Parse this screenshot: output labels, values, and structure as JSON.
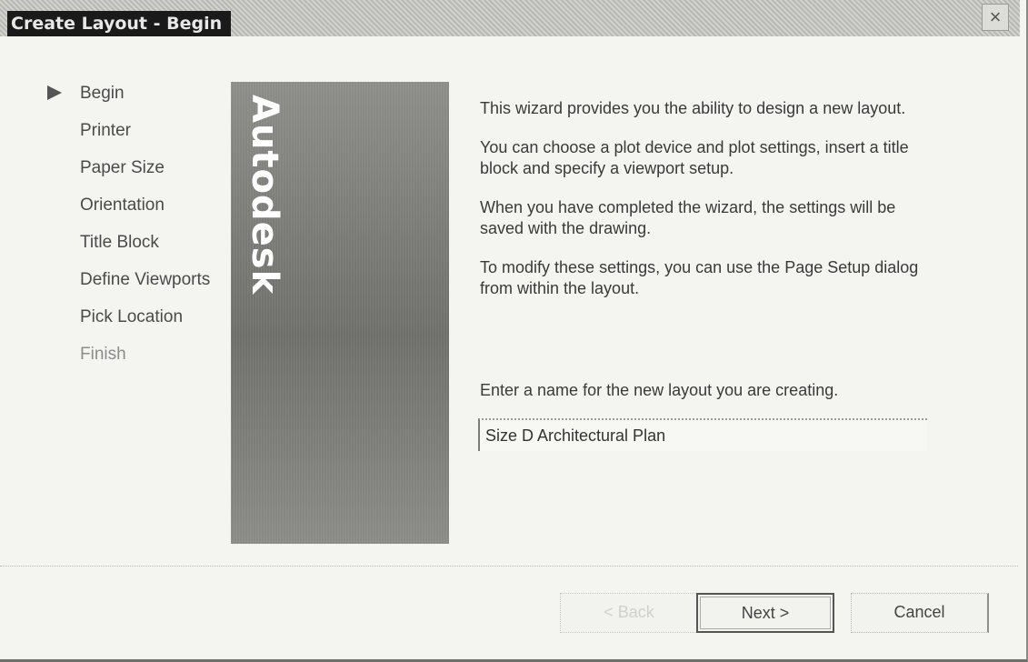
{
  "window": {
    "title": "Create Layout - Begin",
    "close_label": "×"
  },
  "steps": [
    {
      "label": "Begin",
      "current": true
    },
    {
      "label": "Printer",
      "current": false
    },
    {
      "label": "Paper Size",
      "current": false
    },
    {
      "label": "Orientation",
      "current": false
    },
    {
      "label": "Title Block",
      "current": false
    },
    {
      "label": "Define Viewports",
      "current": false
    },
    {
      "label": "Pick Location",
      "current": false
    },
    {
      "label": "Finish",
      "current": false
    }
  ],
  "brand": {
    "logo_text": "Autodesk"
  },
  "content": {
    "paragraphs": [
      "This wizard provides you the ability to design a new layout.",
      "You can choose a plot device and plot settings, insert a title block and specify a viewport setup.",
      "When you have completed the wizard, the settings will be saved with the drawing.",
      "To modify these settings, you can use the Page Setup dialog from within the layout."
    ],
    "name_prompt": "Enter a name for the new layout you are creating.",
    "name_value": "Size D Architectural Plan"
  },
  "buttons": {
    "back": "< Back",
    "next": "Next >",
    "cancel": "Cancel"
  }
}
